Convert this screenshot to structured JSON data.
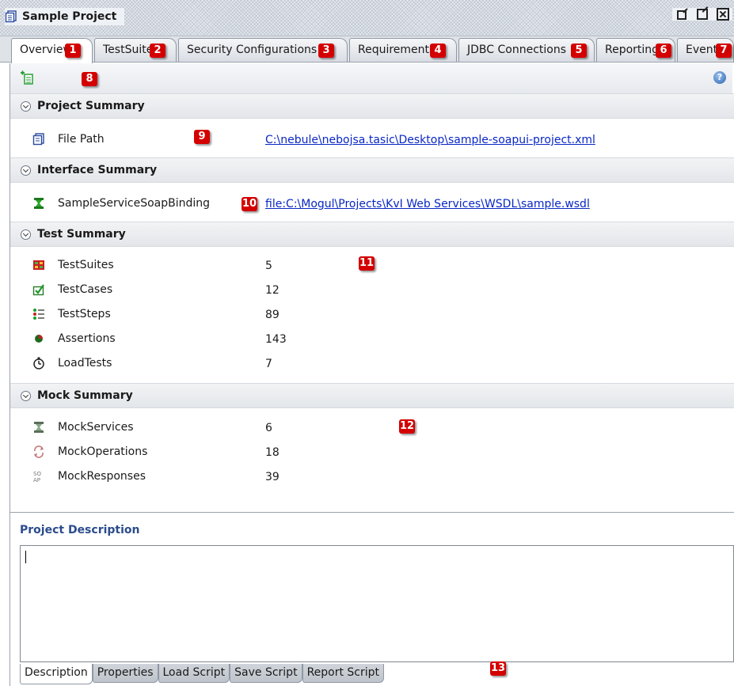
{
  "window": {
    "title": "Sample Project",
    "icon": "project-doc-icon"
  },
  "tabs": [
    {
      "label": "Overview",
      "marker": "1",
      "active": true
    },
    {
      "label": "TestSuites",
      "marker": "2"
    },
    {
      "label": "Security Configurations",
      "marker": "3"
    },
    {
      "label": "Requirements",
      "marker": "4"
    },
    {
      "label": "JDBC Connections",
      "marker": "5"
    },
    {
      "label": "Reporting",
      "marker": "6"
    },
    {
      "label": "Events",
      "marker": "7"
    }
  ],
  "toolbar": {
    "marker": "8",
    "help_label": "?"
  },
  "project_summary": {
    "title": "Project Summary",
    "file_path_label": "File Path",
    "file_path_value": "C:\\nebule\\nebojsa.tasic\\Desktop\\sample-soapui-project.xml",
    "marker": "9"
  },
  "interface_summary": {
    "title": "Interface Summary",
    "binding_label": "SampleServiceSoapBinding",
    "binding_value": "file:C:\\Mogul\\Projects\\KvI Web Services\\WSDL\\sample.wsdl",
    "marker": "10"
  },
  "test_summary": {
    "title": "Test Summary",
    "marker": "11",
    "rows": [
      {
        "label": "TestSuites",
        "value": "5",
        "icon": "testsuites-icon"
      },
      {
        "label": "TestCases",
        "value": "12",
        "icon": "testcases-icon"
      },
      {
        "label": "TestSteps",
        "value": "89",
        "icon": "teststeps-icon"
      },
      {
        "label": "Assertions",
        "value": "143",
        "icon": "assertions-icon"
      },
      {
        "label": "LoadTests",
        "value": "7",
        "icon": "loadtests-icon"
      }
    ]
  },
  "mock_summary": {
    "title": "Mock Summary",
    "marker": "12",
    "rows": [
      {
        "label": "MockServices",
        "value": "6",
        "icon": "mockservices-icon"
      },
      {
        "label": "MockOperations",
        "value": "18",
        "icon": "mockoperations-icon"
      },
      {
        "label": "MockResponses",
        "value": "39",
        "icon": "mockresponses-icon"
      }
    ]
  },
  "description": {
    "title": "Project Description",
    "value": "",
    "marker": "13",
    "tabs": [
      "Description",
      "Properties",
      "Load Script",
      "Save Script",
      "Report Script"
    ]
  },
  "colors": {
    "link": "#0a27c4",
    "marker": "#d40000",
    "desc_title": "#2b4c8c"
  }
}
